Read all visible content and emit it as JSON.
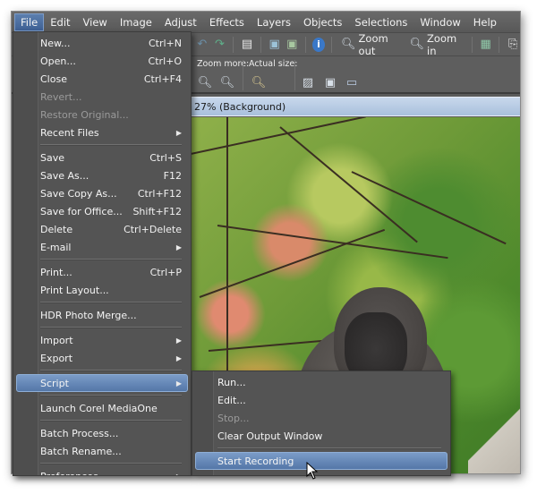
{
  "menubar": {
    "items": [
      {
        "label": "File",
        "active": true
      },
      {
        "label": "Edit"
      },
      {
        "label": "View"
      },
      {
        "label": "Image"
      },
      {
        "label": "Adjust"
      },
      {
        "label": "Effects"
      },
      {
        "label": "Layers"
      },
      {
        "label": "Objects"
      },
      {
        "label": "Selections"
      },
      {
        "label": "Window"
      },
      {
        "label": "Help"
      }
    ]
  },
  "toolbar": {
    "undo_icon": "undo-icon",
    "redo_icon": "redo-icon",
    "zoom_out_label": "Zoom out",
    "zoom_in_label": "Zoom in",
    "zoom_more_label": "Zoom more:",
    "actual_size_label": "Actual size:"
  },
  "document": {
    "title": "27% (Background)"
  },
  "file_menu": {
    "items": [
      {
        "label": "New...",
        "shortcut": "Ctrl+N"
      },
      {
        "label": "Open...",
        "shortcut": "Ctrl+O"
      },
      {
        "label": "Close",
        "shortcut": "Ctrl+F4"
      },
      {
        "label": "Revert...",
        "shortcut": "",
        "disabled": true
      },
      {
        "label": "Restore Original...",
        "shortcut": "",
        "disabled": true
      },
      {
        "label": "Recent Files",
        "submenu": true
      },
      {
        "label": "Save",
        "shortcut": "Ctrl+S"
      },
      {
        "label": "Save As...",
        "shortcut": "F12"
      },
      {
        "label": "Save Copy As...",
        "shortcut": "Ctrl+F12"
      },
      {
        "label": "Save for Office...",
        "shortcut": "Shift+F12"
      },
      {
        "label": "Delete",
        "shortcut": "Ctrl+Delete"
      },
      {
        "label": "E-mail",
        "submenu": true
      },
      {
        "label": "Print...",
        "shortcut": "Ctrl+P"
      },
      {
        "label": "Print Layout..."
      },
      {
        "label": "HDR Photo Merge..."
      },
      {
        "label": "Import",
        "submenu": true
      },
      {
        "label": "Export",
        "submenu": true
      },
      {
        "label": "Script",
        "submenu": true,
        "highlighted": true
      },
      {
        "label": "Launch Corel MediaOne"
      },
      {
        "label": "Batch Process..."
      },
      {
        "label": "Batch Rename..."
      },
      {
        "label": "Preferences",
        "submenu": true
      }
    ]
  },
  "script_menu": {
    "items": [
      {
        "label": "Run..."
      },
      {
        "label": "Edit..."
      },
      {
        "label": "Stop...",
        "disabled": true
      },
      {
        "label": "Clear Output Window"
      },
      {
        "label": "Start Recording",
        "highlighted": true
      }
    ]
  },
  "colors": {
    "highlight": "#5f82b2",
    "menu_bg": "#545454",
    "title_bar": "#b8cce4"
  }
}
